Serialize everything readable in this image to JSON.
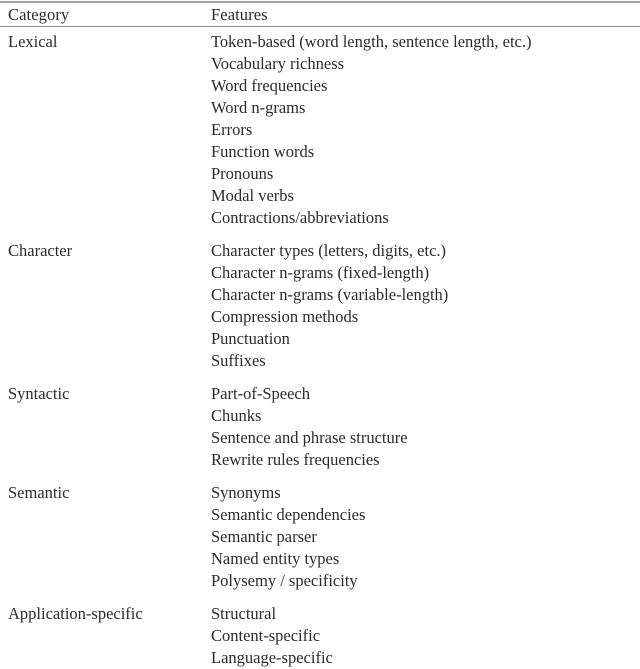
{
  "document": {
    "type": "academic-table",
    "style": "booktabs",
    "background_color": "#ffffff",
    "text_color": "#2b2b2b",
    "rule_color": "#9a9a9a"
  },
  "table": {
    "columns": [
      {
        "key": "category",
        "header": "Category"
      },
      {
        "key": "features",
        "header": "Features"
      }
    ],
    "groups": [
      {
        "category": "Lexical",
        "features": [
          "Token-based (word length, sentence length, etc.)",
          "Vocabulary richness",
          "Word frequencies",
          "Word n-grams",
          "Errors",
          "Function words",
          "Pronouns",
          "Modal verbs",
          "Contractions/abbreviations"
        ]
      },
      {
        "category": "Character",
        "features": [
          "Character types (letters, digits, etc.)",
          "Character n-grams (fixed-length)",
          "Character n-grams (variable-length)",
          "Compression methods",
          "Punctuation",
          "Suffixes"
        ]
      },
      {
        "category": "Syntactic",
        "features": [
          "Part-of-Speech",
          "Chunks",
          "Sentence and phrase structure",
          "Rewrite rules frequencies"
        ]
      },
      {
        "category": "Semantic",
        "features": [
          "Synonyms",
          "Semantic dependencies",
          "Semantic parser",
          "Named entity types",
          "Polysemy / specificity"
        ]
      },
      {
        "category": "Application-specific",
        "features": [
          "Structural",
          "Content-specific",
          "Language-specific"
        ]
      }
    ]
  }
}
